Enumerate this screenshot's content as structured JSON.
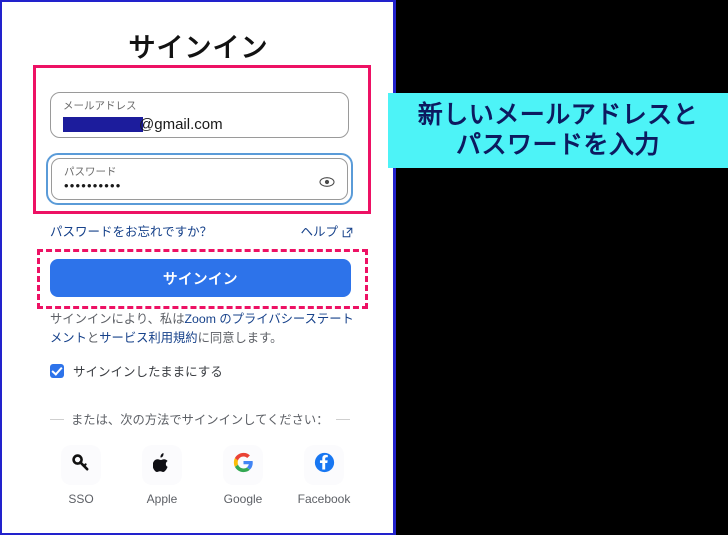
{
  "window": {
    "border_color": "#2222cc",
    "background_color": "#000000",
    "panel_background": "#ffffff"
  },
  "signin": {
    "title": "サインイン",
    "email_field": {
      "label": "メールアドレス",
      "redacted": true,
      "value_visible": "@gmail.com",
      "placeholder": "メールアドレス"
    },
    "password_field": {
      "label": "パスワード",
      "value_masked": "••••••••••",
      "placeholder": "パスワード",
      "reveal_icon": "eye-icon",
      "focused": true
    },
    "forgot_password_link": "パスワードをお忘れですか？",
    "help_link": "ヘルプ",
    "help_icon": "external-link-icon",
    "submit_button": "サインイン",
    "terms": {
      "part1": "サインインにより、私は",
      "link1": "Zoom のプライバシーステートメント",
      "part2": "と",
      "link2": "サービス利用規約",
      "part3": "に同意します。"
    },
    "keep_signed_in": {
      "label": "サインインしたままにする",
      "checked": true
    },
    "divider_text": "または、次の方法でサインインしてください：",
    "social": [
      {
        "label": "SSO",
        "icon": "key-icon"
      },
      {
        "label": "Apple",
        "icon": "apple-icon"
      },
      {
        "label": "Google",
        "icon": "google-icon"
      },
      {
        "label": "Facebook",
        "icon": "facebook-icon"
      }
    ]
  },
  "annotations": {
    "fields_highlight": {
      "style": "solid",
      "color": "#ed1164"
    },
    "button_highlight": {
      "style": "dashed",
      "color": "#ed1164"
    },
    "callout": {
      "background": "#4df3f7",
      "text_color": "#0d1a60",
      "line1": "新しいメールアドレスと",
      "line2": "パスワードを入力"
    }
  }
}
